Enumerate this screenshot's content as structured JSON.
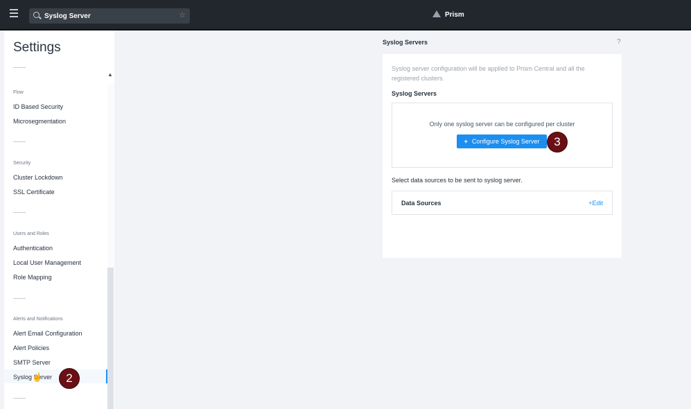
{
  "search": {
    "value": "Syslog Server"
  },
  "brand": "Prism",
  "sidebar": {
    "title": "Settings",
    "sections": [
      {
        "heading": "Flow",
        "items": [
          "ID Based Security",
          "Microsegmentation"
        ]
      },
      {
        "heading": "Security",
        "items": [
          "Cluster Lockdown",
          "SSL Certificate"
        ]
      },
      {
        "heading": "Users and Roles",
        "items": [
          "Authentication",
          "Local User Management",
          "Role Mapping"
        ]
      },
      {
        "heading": "Alerts and Notifications",
        "items": [
          "Alert Email Configuration",
          "Alert Policies",
          "SMTP Server",
          "Syslog Server"
        ]
      }
    ]
  },
  "steps": {
    "sidebar_step": "2",
    "button_step": "3"
  },
  "panel": {
    "title": "Syslog Servers",
    "help": "?",
    "description": "Syslog server configuration will be applied to Prism Central and all the registered clusters.",
    "subtitle": "Syslog Servers",
    "note": "Only one syslog server can be configured per cluster",
    "configure_button": "Configure Syslog Server",
    "select_label": "Select data sources to be sent to syslog server.",
    "data_sources_label": "Data Sources",
    "edit_label": "+Edit"
  },
  "colors": {
    "accent": "#1c8ef0",
    "topbar": "#22272e",
    "badge": "#6b0f16"
  }
}
